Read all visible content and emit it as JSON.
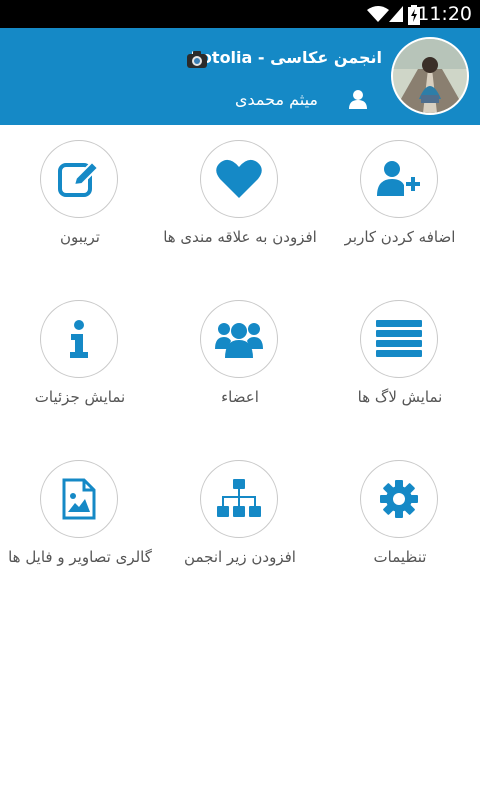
{
  "status_bar": {
    "time": "11:20"
  },
  "header": {
    "group_title": "انجمن عکاسی - Fotolia",
    "user_name": "میثم محمدی",
    "header_color": "#1589c6"
  },
  "tiles": [
    {
      "label": "اضافه کردن کاربر",
      "icon": "add-user-icon"
    },
    {
      "label": "افزودن به علاقه مندی ها",
      "icon": "heart-icon"
    },
    {
      "label": "تریبون",
      "icon": "edit-icon"
    },
    {
      "label": "نمایش لاگ ها",
      "icon": "list-icon"
    },
    {
      "label": "اعضاء",
      "icon": "members-icon"
    },
    {
      "label": "نمایش جزئیات",
      "icon": "info-icon"
    },
    {
      "label": "تنظیمات",
      "icon": "gear-icon"
    },
    {
      "label": "افزودن زیر انجمن",
      "icon": "sitemap-icon"
    },
    {
      "label": "گالری تصاویر و فایل ها",
      "icon": "image-file-icon"
    }
  ],
  "accent_color": "#1589c6"
}
